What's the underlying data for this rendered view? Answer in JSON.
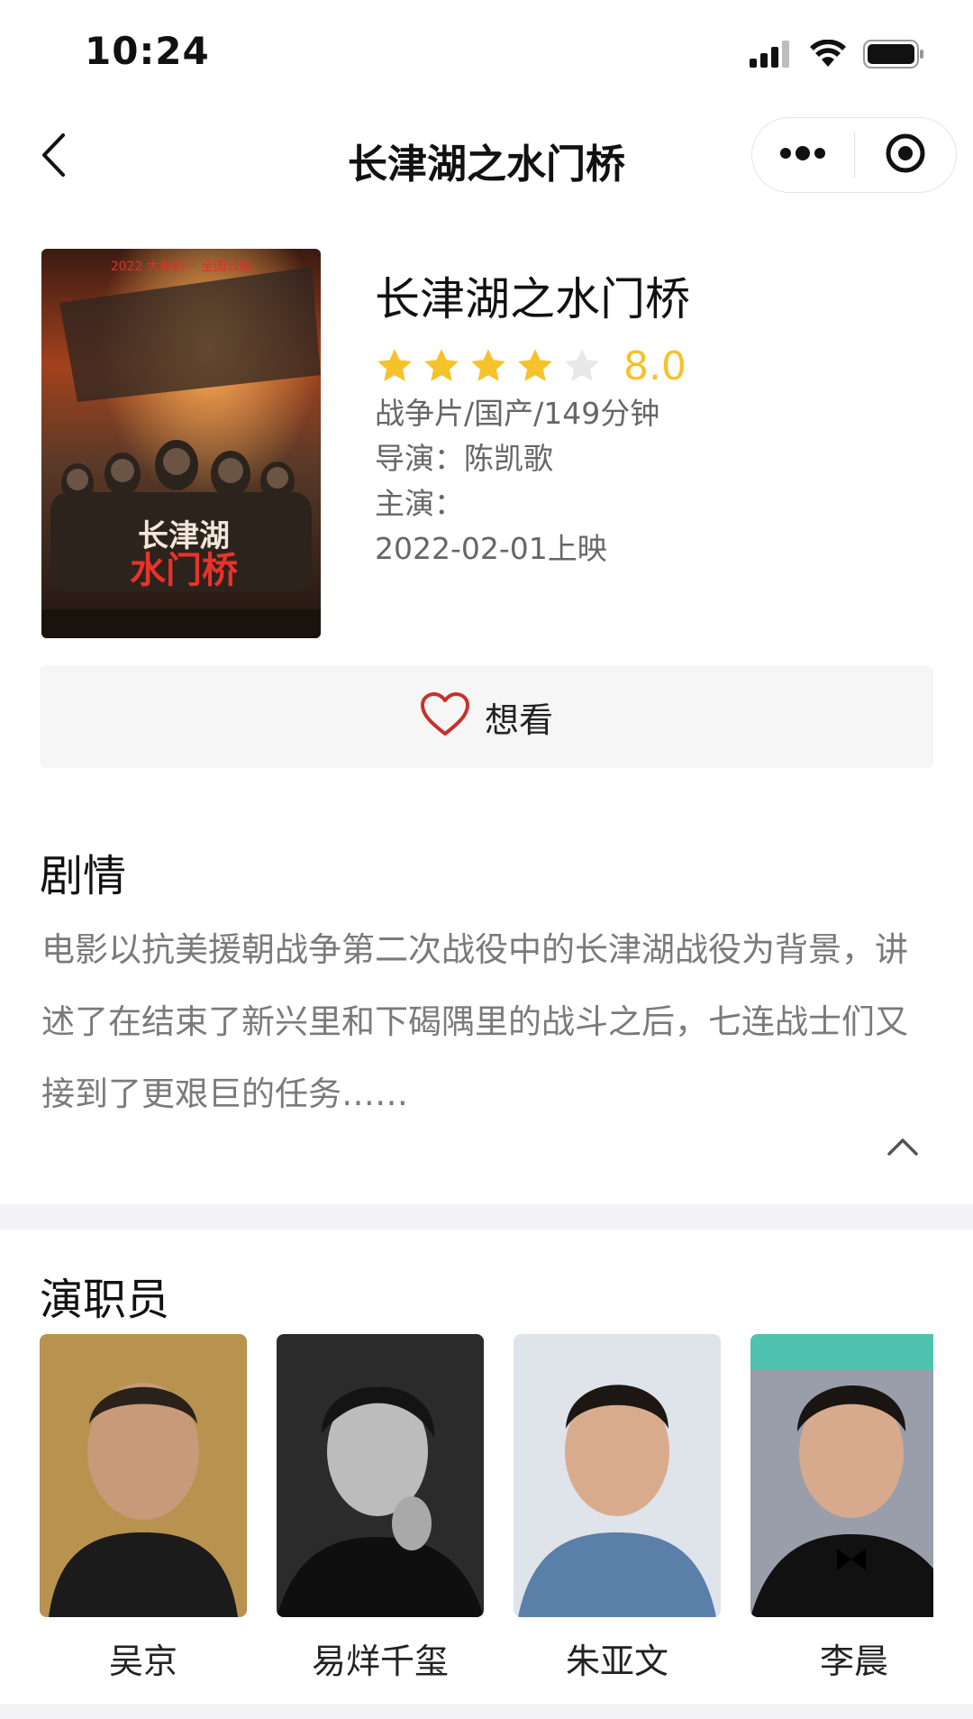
{
  "status_bar": {
    "time": "10:24",
    "icons": [
      "signal-icon",
      "wifi-icon",
      "battery-icon"
    ]
  },
  "nav": {
    "title": "长津湖之水门桥",
    "back_icon": "chevron-left-icon",
    "more_icon": "more-dots-icon",
    "close_icon": "target-circle-icon"
  },
  "movie": {
    "title": "长津湖之水门桥",
    "rating": 8.0,
    "rating_text": "8.0",
    "stars_filled": 4,
    "stars_total": 5,
    "genre_line": "战争片/国产/149分钟",
    "director_line": "导演：陈凯歌",
    "cast_line": "主演：",
    "release_line": "2022-02-01上映",
    "poster": {
      "top_text": "2022 大年初一 全国公映",
      "title_line1": "长津湖",
      "title_line2": "水门桥"
    }
  },
  "want_button": {
    "label": "想看",
    "icon": "heart-outline-icon"
  },
  "plot": {
    "title": "剧情",
    "text": "电影以抗美援朝战争第二次战役中的长津湖战役为背景，讲述了在结束了新兴里和下碣隅里的战斗之后，七连战士们又接到了更艰巨的任务……",
    "toggle_icon": "chevron-up-icon"
  },
  "cast": {
    "title": "演职员",
    "members": [
      {
        "name": "吴京"
      },
      {
        "name": "易烊千玺"
      },
      {
        "name": "朱亚文"
      },
      {
        "name": "李晨"
      }
    ]
  },
  "colors": {
    "star_active": "#f6c22b",
    "star_inactive": "#e8e8e8",
    "heart": "#c9302c",
    "rating_text": "#f6c22b",
    "meta_text": "#666666",
    "plot_text": "#7a7a7a",
    "section_band": "#f4f4f6"
  }
}
